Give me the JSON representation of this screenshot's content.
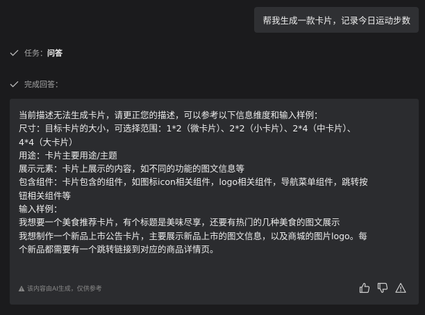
{
  "user_message": "帮我生成一款卡片，记录今日运动步数",
  "steps": {
    "task": {
      "label": "任务：",
      "value": "问答"
    },
    "done": {
      "label": "完成回答："
    }
  },
  "answer": {
    "lines": [
      "当前描述无法生成卡片，请更正您的描述，可以参考以下信息维度和输入样例：",
      "尺寸：目标卡片的大小，可选择范围：1*2（微卡片）、2*2（小卡片）、2*4（中卡片）、",
      "4*4（大卡片）",
      "用途：卡片主要用途/主题",
      "展示元素：卡片上展示的内容，如不同的功能的图文信息等",
      "包含组件：卡片包含的组件，如图标icon相关组件，logo相关组件，导航菜单组件，跳转按",
      "钮相关组件等",
      "输入样例：",
      "我想要一个美食推荐卡片，有个标题是美味尽享，还要有热门的几种美食的图文展示",
      "我想制作一个新品上市公告卡片，主要展示新品上市的图文信息，以及商城的图片logo。每",
      "个新品都需要有一个跳转链接到对应的商品详情页。"
    ],
    "disclaimer": "该内容由AI生成，仅供参考"
  },
  "icons": {
    "step_check": "check-icon",
    "disclaimer": "warning-icon",
    "like": "thumbs-up-icon",
    "dislike": "thumbs-down-icon",
    "report": "warning-icon"
  }
}
